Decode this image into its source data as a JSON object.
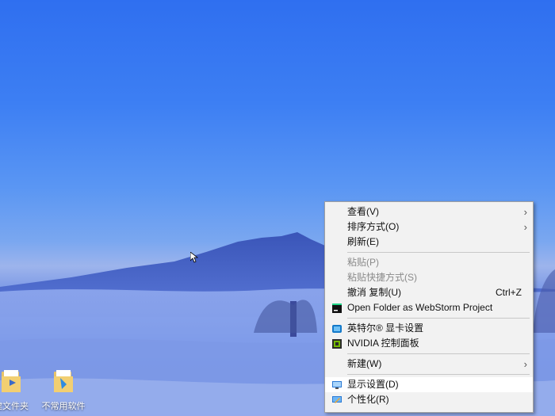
{
  "desktop": {
    "icons": [
      {
        "label": "建文件夹",
        "icon": "folder-icon"
      },
      {
        "label": "不常用软件",
        "icon": "folder-icon"
      }
    ]
  },
  "context_menu": {
    "groups": [
      [
        {
          "label": "查看(V)",
          "submenu": true,
          "disabled": false
        },
        {
          "label": "排序方式(O)",
          "submenu": true,
          "disabled": false
        },
        {
          "label": "刷新(E)",
          "submenu": false,
          "disabled": false
        }
      ],
      [
        {
          "label": "粘贴(P)",
          "disabled": true
        },
        {
          "label": "粘贴快捷方式(S)",
          "disabled": true
        },
        {
          "label": "撤消 复制(U)",
          "shortcut": "Ctrl+Z",
          "disabled": false
        },
        {
          "label": "Open Folder as WebStorm Project",
          "icon": "webstorm-icon",
          "disabled": false
        }
      ],
      [
        {
          "label": "英特尔® 显卡设置",
          "icon": "intel-graphics-icon",
          "disabled": false
        },
        {
          "label": "NVIDIA 控制面板",
          "icon": "nvidia-icon",
          "disabled": false
        }
      ],
      [
        {
          "label": "新建(W)",
          "submenu": true,
          "disabled": false
        }
      ],
      [
        {
          "label": "显示设置(D)",
          "icon": "display-settings-icon",
          "hovered": true,
          "disabled": false
        },
        {
          "label": "个性化(R)",
          "icon": "personalize-icon",
          "disabled": false
        }
      ]
    ]
  },
  "colors": {
    "menu_bg": "#f2f2f2",
    "menu_hover": "#ffffff",
    "disabled_text": "#8a8a8a"
  }
}
